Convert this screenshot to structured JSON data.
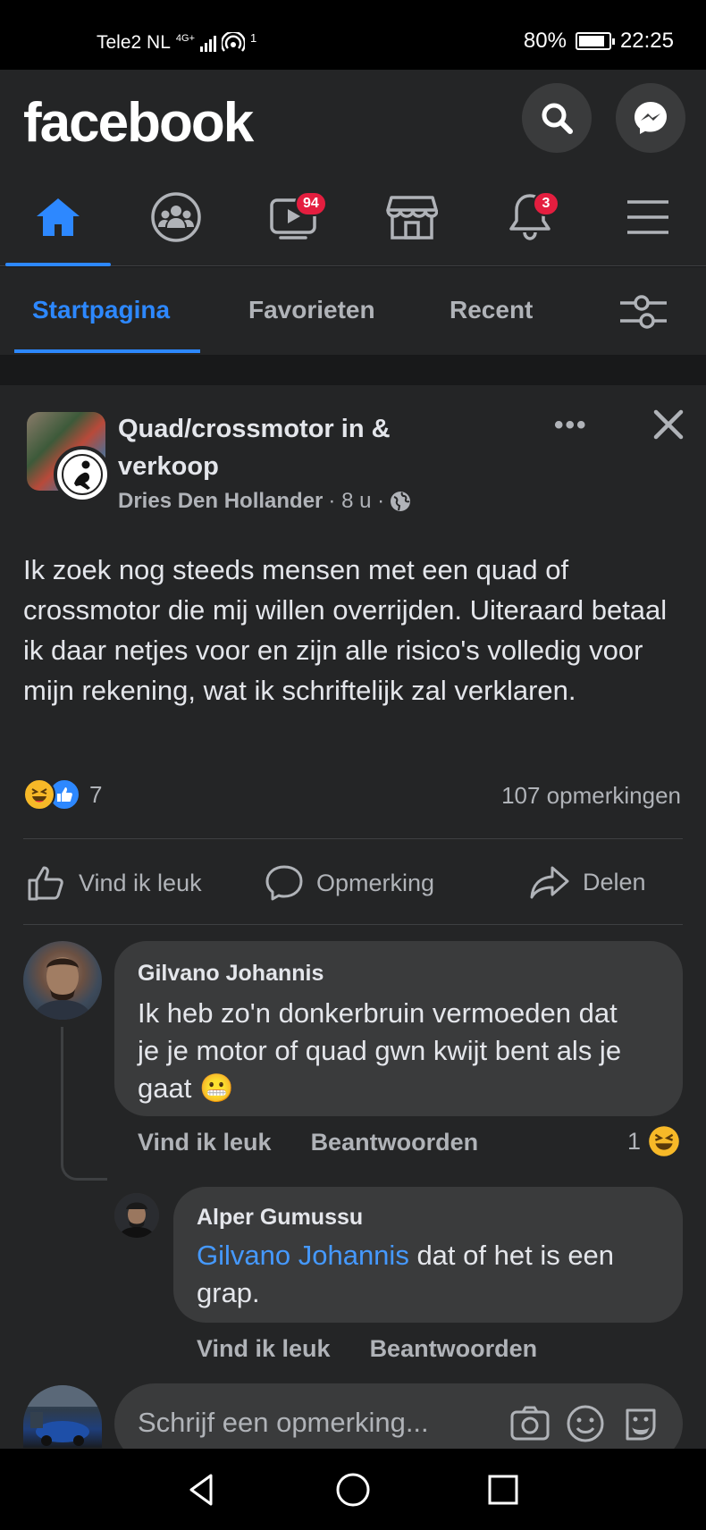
{
  "status_bar": {
    "carrier": "Tele2 NL",
    "network": "4G+",
    "hotspot_count": "1",
    "battery": "80%",
    "time": "22:25"
  },
  "header": {
    "logo": "facebook",
    "icons": [
      "search-icon",
      "messenger-icon"
    ]
  },
  "nav": {
    "items": [
      {
        "name": "home-icon",
        "active": true
      },
      {
        "name": "groups-icon",
        "badge": ""
      },
      {
        "name": "watch-icon",
        "badge": "94"
      },
      {
        "name": "marketplace-icon",
        "badge": ""
      },
      {
        "name": "notifications-icon",
        "badge": "3"
      },
      {
        "name": "menu-icon",
        "badge": ""
      }
    ],
    "watch_badge": "94",
    "notifications_badge": "3"
  },
  "tabs": {
    "home": "Startpagina",
    "favorites": "Favorieten",
    "recent": "Recent"
  },
  "post": {
    "group_name": "Quad/crossmotor in & verkoop",
    "author": "Dries Den Hollander",
    "time": "· 8 u ·",
    "text": "Ik zoek nog steeds mensen met een quad of crossmotor die mij willen overrijden. Uiteraard betaal ik daar netjes voor en zijn alle risico's volledig voor mijn rekening, wat ik schriftelijk zal verklaren.",
    "reaction_count": "7",
    "comment_count": "107 opmerkingen",
    "actions": {
      "like": "Vind ik leuk",
      "comment": "Opmerking",
      "share": "Delen"
    }
  },
  "comments": [
    {
      "name": "Gilvano Johannis",
      "text": "Ik heb zo'n donkerbruin vermoeden dat je je motor of quad gwn kwijt bent als je gaat",
      "emoji": "😬",
      "like_label": "Vind ik leuk",
      "reply_label": "Beantwoorden",
      "reaction_count": "1"
    },
    {
      "name": "Alper Gumussu",
      "mention": "Gilvano Johannis",
      "text": " dat of het is een grap.",
      "like_label": "Vind ik leuk",
      "reply_label": "Beantwoorden"
    }
  ],
  "compose": {
    "placeholder": "Schrijf een opmerking..."
  },
  "colors": {
    "accent": "#2d88ff",
    "background": "#18191a",
    "surface": "#242526",
    "bubble": "#3a3b3c",
    "badge": "#e41e3f"
  }
}
